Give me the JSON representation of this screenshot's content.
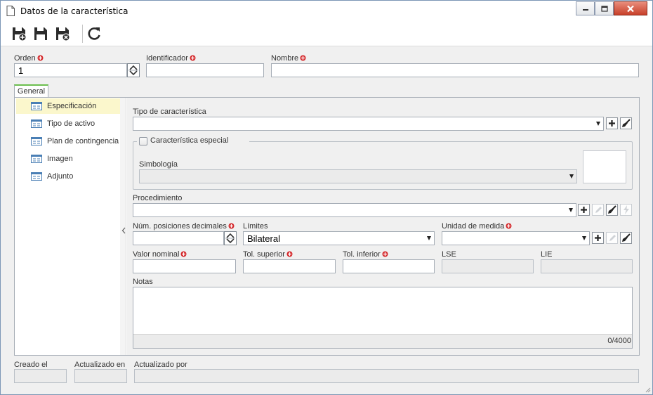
{
  "window": {
    "title": "Datos de la característica",
    "controls": [
      "minimize",
      "maximize",
      "close"
    ]
  },
  "toolbar": {
    "buttons": [
      {
        "name": "save-and-new",
        "icon": "save-plus-icon"
      },
      {
        "name": "save",
        "icon": "save-icon"
      },
      {
        "name": "save-and-close",
        "icon": "save-close-icon"
      },
      {
        "name": "refresh",
        "icon": "refresh-icon"
      }
    ]
  },
  "header": {
    "orden_label": "Orden",
    "orden_value": "1",
    "identificador_label": "Identificador",
    "identificador_value": "",
    "nombre_label": "Nombre",
    "nombre_value": ""
  },
  "tabs": [
    {
      "label": "General",
      "active": true
    }
  ],
  "nav": [
    {
      "label": "Especificación",
      "active": true
    },
    {
      "label": "Tipo de activo",
      "active": false
    },
    {
      "label": "Plan de contingencia",
      "active": false
    },
    {
      "label": "Imagen",
      "active": false
    },
    {
      "label": "Adjunto",
      "active": false
    }
  ],
  "form": {
    "tipo_label": "Tipo de característica",
    "tipo_value": "",
    "especial_label": "Característica especial",
    "especial_checked": false,
    "simbologia_label": "Simbología",
    "simbologia_value": "",
    "procedimiento_label": "Procedimiento",
    "procedimiento_value": "",
    "decimales_label": "Núm. posiciones decimales",
    "decimales_value": "",
    "limites_label": "Límites",
    "limites_value": "Bilateral",
    "unidad_label": "Unidad de medida",
    "unidad_value": "",
    "valor_nominal_label": "Valor nominal",
    "tol_superior_label": "Tol. superior",
    "tol_inferior_label": "Tol. inferior",
    "lse_label": "LSE",
    "lie_label": "LIE",
    "notas_label": "Notas",
    "notas_counter": "0/4000"
  },
  "footer": {
    "creado_label": "Creado el",
    "actualizado_en_label": "Actualizado en",
    "actualizado_por_label": "Actualizado por"
  },
  "colors": {
    "required": "#d4282b",
    "active_nav": "#fbf7cc",
    "tab_accent": "#6bbf4e",
    "border": "#a5acb5"
  }
}
